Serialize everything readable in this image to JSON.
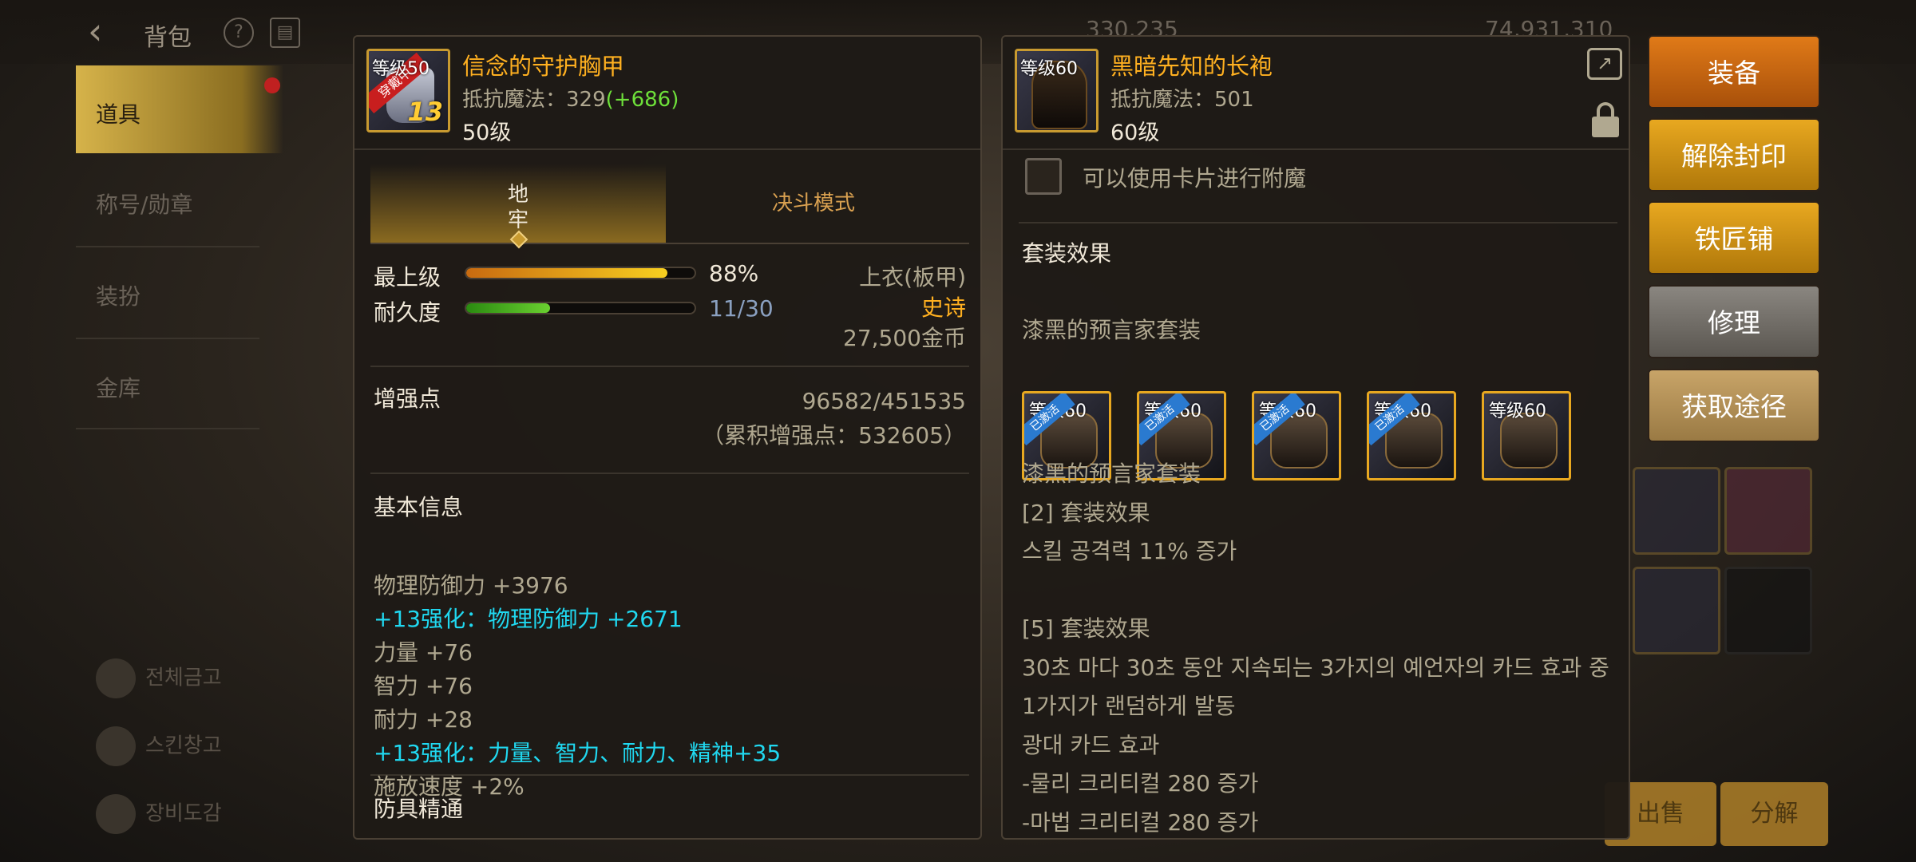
{
  "background": {
    "top_title": "背包",
    "top_numbers": [
      "330,235",
      "74,931,310"
    ],
    "sidebar": [
      "道具",
      "称号/勋章",
      "装扮",
      "金库"
    ],
    "sidebar_bottom": [
      "전체금고",
      "스킨창고",
      "장비도감"
    ],
    "bottom_buttons": [
      "出售",
      "分解"
    ]
  },
  "left_item": {
    "level_tag": "等级50",
    "ribbon": "穿戴中",
    "enhance": "13",
    "name": "信念的守护胸甲",
    "resist_label": "抵抗魔法：329",
    "resist_plus": "(+686)",
    "level": "50级",
    "tabs": {
      "active": "地牢",
      "inactive": "决斗模式"
    },
    "top_grade": {
      "label": "最上级",
      "value": "88%",
      "fraction": 0.88
    },
    "durability": {
      "label": "耐久度",
      "value": "11/30",
      "fraction": 0.367
    },
    "slot_type": "上衣(板甲)",
    "rarity": "史诗",
    "price": "27,500金币",
    "enhance_points": {
      "label": "增强点",
      "value": "96582/451535",
      "cumulative": "（累积增强点：532605）"
    },
    "basic_info": {
      "title": "基本信息",
      "lines": [
        {
          "text": "物理防御力 +3976",
          "color": "#b0a890"
        },
        {
          "text": "+13强化：物理防御力 +2671",
          "color": "#20d8f0"
        },
        {
          "text": "力量 +76",
          "color": "#b0a890"
        },
        {
          "text": "智力 +76",
          "color": "#b0a890"
        },
        {
          "text": "耐力 +28",
          "color": "#b0a890"
        },
        {
          "text": "+13强化：力量、智力、耐力、精神+35",
          "color": "#20d8f0"
        },
        {
          "text": "施放速度 +2%",
          "color": "#b0a890"
        }
      ]
    },
    "mastery_title": "防具精通"
  },
  "right_item": {
    "level_tag": "等级60",
    "name": "黑暗先知的长袍",
    "resist_label": "抵抗魔法：501",
    "level": "60级",
    "card_text": "可以使用卡片进行附魔",
    "set_title": "套装效果",
    "set_name": "漆黑的预言家套装",
    "set_icons": [
      {
        "level": "等级60",
        "ribbon": "已激活"
      },
      {
        "level": "等级60",
        "ribbon": "已激活"
      },
      {
        "level": "等级60",
        "ribbon": "已激活"
      },
      {
        "level": "等级60",
        "ribbon": "已激活"
      },
      {
        "level": "等级60",
        "ribbon": ""
      }
    ],
    "set_lines": [
      "漆黑的预言家套装",
      "[2] 套装效果",
      "스킬 공격력 11% 증가",
      "",
      "[5] 套装效果",
      "30초 마다 30초 동안 지속되는 3가지의 예언자의 카드 효과 중",
      "1가지가 랜덤하게 발동",
      "광대 카드 효과",
      "-물리 크리티컬 280 증가",
      "-마법 크리티컬 280 증가"
    ]
  },
  "actions": [
    "装备",
    "解除封印",
    "铁匠铺",
    "修理",
    "获取途径"
  ]
}
